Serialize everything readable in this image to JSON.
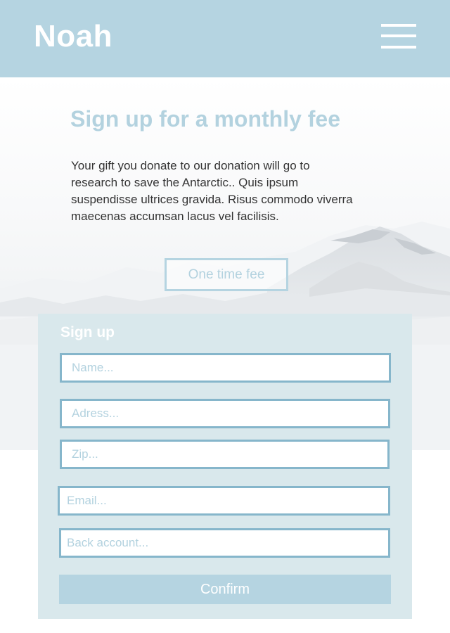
{
  "header": {
    "logo": "Noah",
    "menu_icon": "hamburger-menu-icon"
  },
  "hero": {
    "title": "Sign up for a monthly fee",
    "description": "Your gift you donate to our donation will go to research to save the Antarctic.. Quis ipsum suspendisse ultrices gravida. Risus commodo viverra maecenas accumsan lacus vel facilisis.",
    "one_time_button": "One time fee"
  },
  "form": {
    "title": "Sign up",
    "fields": {
      "name_placeholder": "Name...",
      "address_placeholder": "Adress...",
      "zip_placeholder": "Zip...",
      "email_placeholder": "Email...",
      "bank_placeholder": "Back account..."
    },
    "confirm_button": "Confirm"
  },
  "colors": {
    "accent": "#b5d4e1",
    "field_border": "#86b6cb",
    "card_bg": "#d9e8ec",
    "text": "#333333"
  }
}
